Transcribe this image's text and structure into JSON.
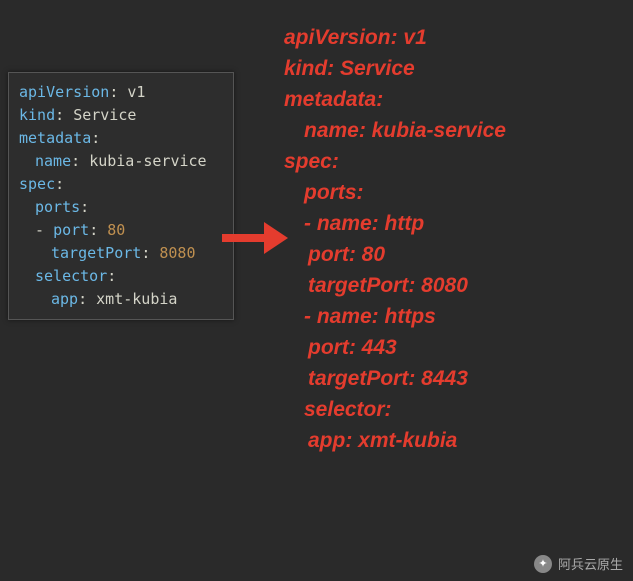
{
  "left": {
    "apiVersion_key": "apiVersion",
    "apiVersion_val": "v1",
    "kind_key": "kind",
    "kind_val": "Service",
    "metadata_key": "metadata",
    "name_key": "name",
    "name_val": "kubia-service",
    "spec_key": "spec",
    "ports_key": "ports",
    "port_key": "port",
    "port_val": "80",
    "targetPort_key": "targetPort",
    "targetPort_val": "8080",
    "selector_key": "selector",
    "app_key": "app",
    "app_val": "xmt-kubia"
  },
  "right": {
    "l1": "apiVersion: v1",
    "l2": "kind: Service",
    "l3": "metadata:",
    "l4": "name: kubia-service",
    "l5": "spec:",
    "l6": "ports:",
    "l7": "- name: http",
    "l8": "port: 80",
    "l9": "targetPort: 8080",
    "l10": "- name: https",
    "l11": "port: 443",
    "l12": "targetPort: 8443",
    "l13": "selector:",
    "l14": "app: xmt-kubia"
  },
  "watermark": {
    "text": "阿兵云原生"
  }
}
